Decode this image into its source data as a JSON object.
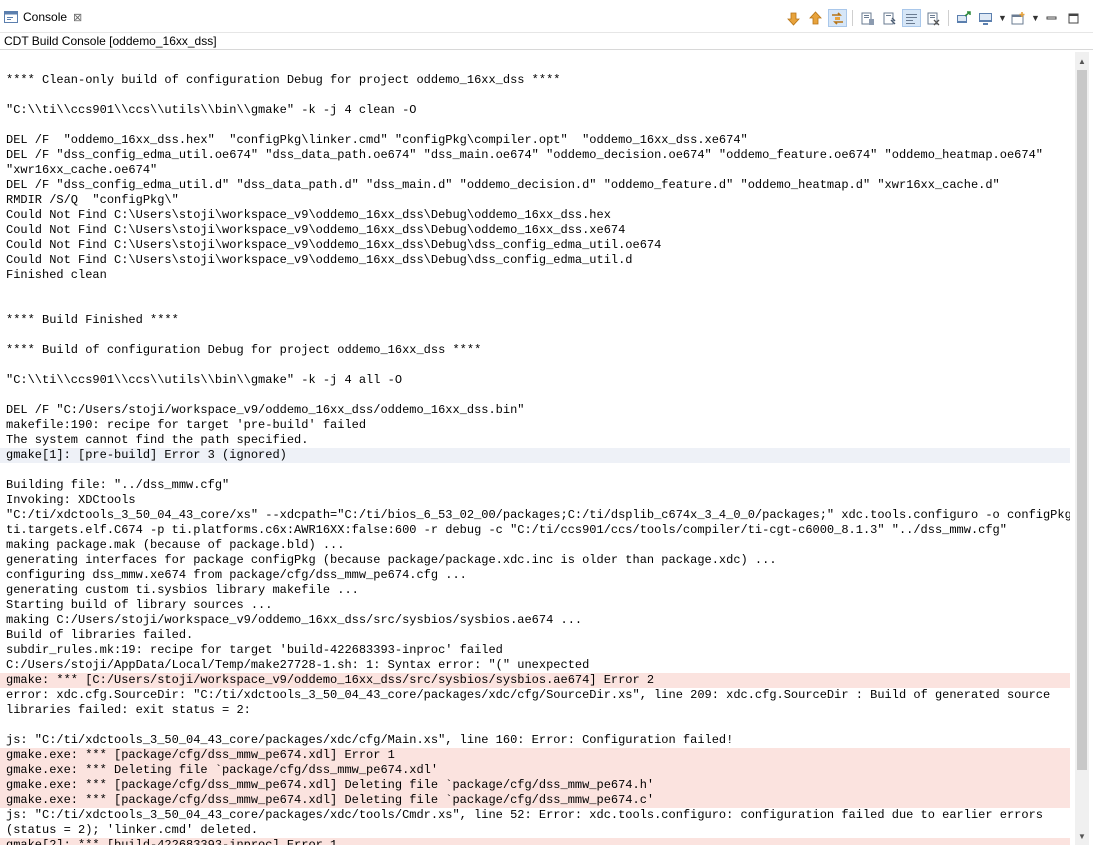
{
  "tab": {
    "title": "Console",
    "close": "⊠"
  },
  "subtitle": "CDT Build Console [oddemo_16xx_dss]",
  "colors": {
    "error_bg": "#fbe3df",
    "highlight_bg": "#eef1f7",
    "accent": "#e8a33c"
  },
  "console": {
    "lines": [
      {
        "text": "",
        "kind": "normal"
      },
      {
        "text": "**** Clean-only build of configuration Debug for project oddemo_16xx_dss ****",
        "kind": "normal"
      },
      {
        "text": "",
        "kind": "normal"
      },
      {
        "text": "\"C:\\\\ti\\\\ccs901\\\\ccs\\\\utils\\\\bin\\\\gmake\" -k -j 4 clean -O",
        "kind": "normal"
      },
      {
        "text": "",
        "kind": "normal"
      },
      {
        "text": "DEL /F  \"oddemo_16xx_dss.hex\"  \"configPkg\\linker.cmd\" \"configPkg\\compiler.opt\"  \"oddemo_16xx_dss.xe674\"",
        "kind": "normal"
      },
      {
        "text": "DEL /F \"dss_config_edma_util.oe674\" \"dss_data_path.oe674\" \"dss_main.oe674\" \"oddemo_decision.oe674\" \"oddemo_feature.oe674\" \"oddemo_heatmap.oe674\"",
        "kind": "normal"
      },
      {
        "text": "\"xwr16xx_cache.oe674\"",
        "kind": "normal"
      },
      {
        "text": "DEL /F \"dss_config_edma_util.d\" \"dss_data_path.d\" \"dss_main.d\" \"oddemo_decision.d\" \"oddemo_feature.d\" \"oddemo_heatmap.d\" \"xwr16xx_cache.d\"",
        "kind": "normal"
      },
      {
        "text": "RMDIR /S/Q  \"configPkg\\\"",
        "kind": "normal"
      },
      {
        "text": "Could Not Find C:\\Users\\stoji\\workspace_v9\\oddemo_16xx_dss\\Debug\\oddemo_16xx_dss.hex",
        "kind": "normal"
      },
      {
        "text": "Could Not Find C:\\Users\\stoji\\workspace_v9\\oddemo_16xx_dss\\Debug\\oddemo_16xx_dss.xe674",
        "kind": "normal"
      },
      {
        "text": "Could Not Find C:\\Users\\stoji\\workspace_v9\\oddemo_16xx_dss\\Debug\\dss_config_edma_util.oe674",
        "kind": "normal"
      },
      {
        "text": "Could Not Find C:\\Users\\stoji\\workspace_v9\\oddemo_16xx_dss\\Debug\\dss_config_edma_util.d",
        "kind": "normal"
      },
      {
        "text": "Finished clean",
        "kind": "normal"
      },
      {
        "text": "",
        "kind": "normal"
      },
      {
        "text": "",
        "kind": "normal"
      },
      {
        "text": "**** Build Finished ****",
        "kind": "normal"
      },
      {
        "text": "",
        "kind": "normal"
      },
      {
        "text": "**** Build of configuration Debug for project oddemo_16xx_dss ****",
        "kind": "normal"
      },
      {
        "text": "",
        "kind": "normal"
      },
      {
        "text": "\"C:\\\\ti\\\\ccs901\\\\ccs\\\\utils\\\\bin\\\\gmake\" -k -j 4 all -O",
        "kind": "normal"
      },
      {
        "text": "",
        "kind": "normal"
      },
      {
        "text": "DEL /F \"C:/Users/stoji/workspace_v9/oddemo_16xx_dss/oddemo_16xx_dss.bin\"",
        "kind": "normal"
      },
      {
        "text": "makefile:190: recipe for target 'pre-build' failed",
        "kind": "normal"
      },
      {
        "text": "The system cannot find the path specified.",
        "kind": "normal"
      },
      {
        "text": "gmake[1]: [pre-build] Error 3 (ignored)",
        "kind": "hl"
      },
      {
        "text": "",
        "kind": "normal"
      },
      {
        "text": "Building file: \"../dss_mmw.cfg\"",
        "kind": "normal"
      },
      {
        "text": "Invoking: XDCtools",
        "kind": "normal"
      },
      {
        "text": "\"C:/ti/xdctools_3_50_04_43_core/xs\" --xdcpath=\"C:/ti/bios_6_53_02_00/packages;C:/ti/dsplib_c674x_3_4_0_0/packages;\" xdc.tools.configuro -o configPkg -t",
        "kind": "normal"
      },
      {
        "text": "ti.targets.elf.C674 -p ti.platforms.c6x:AWR16XX:false:600 -r debug -c \"C:/ti/ccs901/ccs/tools/compiler/ti-cgt-c6000_8.1.3\" \"../dss_mmw.cfg\"",
        "kind": "normal"
      },
      {
        "text": "making package.mak (because of package.bld) ...",
        "kind": "normal"
      },
      {
        "text": "generating interfaces for package configPkg (because package/package.xdc.inc is older than package.xdc) ...",
        "kind": "normal"
      },
      {
        "text": "configuring dss_mmw.xe674 from package/cfg/dss_mmw_pe674.cfg ...",
        "kind": "normal"
      },
      {
        "text": "generating custom ti.sysbios library makefile ...",
        "kind": "normal"
      },
      {
        "text": "Starting build of library sources ...",
        "kind": "normal"
      },
      {
        "text": "making C:/Users/stoji/workspace_v9/oddemo_16xx_dss/src/sysbios/sysbios.ae674 ...",
        "kind": "normal"
      },
      {
        "text": "Build of libraries failed.",
        "kind": "normal"
      },
      {
        "text": "subdir_rules.mk:19: recipe for target 'build-422683393-inproc' failed",
        "kind": "normal"
      },
      {
        "text": "C:/Users/stoji/AppData/Local/Temp/make27728-1.sh: 1: Syntax error: \"(\" unexpected",
        "kind": "normal"
      },
      {
        "text": "gmake: *** [C:/Users/stoji/workspace_v9/oddemo_16xx_dss/src/sysbios/sysbios.ae674] Error 2",
        "kind": "err"
      },
      {
        "text": "error: xdc.cfg.SourceDir: \"C:/ti/xdctools_3_50_04_43_core/packages/xdc/cfg/SourceDir.xs\", line 209: xdc.cfg.SourceDir : Build of generated source",
        "kind": "normal"
      },
      {
        "text": "libraries failed: exit status = 2:",
        "kind": "normal"
      },
      {
        "text": "",
        "kind": "normal"
      },
      {
        "text": "js: \"C:/ti/xdctools_3_50_04_43_core/packages/xdc/cfg/Main.xs\", line 160: Error: Configuration failed!",
        "kind": "normal"
      },
      {
        "text": "gmake.exe: *** [package/cfg/dss_mmw_pe674.xdl] Error 1",
        "kind": "err"
      },
      {
        "text": "gmake.exe: *** Deleting file `package/cfg/dss_mmw_pe674.xdl'",
        "kind": "err"
      },
      {
        "text": "gmake.exe: *** [package/cfg/dss_mmw_pe674.xdl] Deleting file `package/cfg/dss_mmw_pe674.h'",
        "kind": "err"
      },
      {
        "text": "gmake.exe: *** [package/cfg/dss_mmw_pe674.xdl] Deleting file `package/cfg/dss_mmw_pe674.c'",
        "kind": "err"
      },
      {
        "text": "js: \"C:/ti/xdctools_3_50_04_43_core/packages/xdc/tools/Cmdr.xs\", line 52: Error: xdc.tools.configuro: configuration failed due to earlier errors",
        "kind": "normal"
      },
      {
        "text": "(status = 2); 'linker.cmd' deleted.",
        "kind": "normal"
      },
      {
        "text": "gmake[2]: *** [build-422683393-inproc] Error 1",
        "kind": "err"
      }
    ]
  },
  "toolbar": {
    "icons": [
      {
        "name": "next-error-icon",
        "active": false
      },
      {
        "name": "previous-error-icon",
        "active": false
      },
      {
        "name": "link-with-editor-icon",
        "active": true
      },
      {
        "sep": true
      },
      {
        "name": "scroll-lock-icon",
        "active": false
      },
      {
        "name": "pin-console-icon",
        "active": false
      },
      {
        "name": "word-wrap-icon",
        "active": true
      },
      {
        "name": "clear-console-icon",
        "active": false
      },
      {
        "sep": true
      },
      {
        "name": "open-console-icon",
        "active": false
      },
      {
        "name": "display-console-icon",
        "active": false,
        "caret": true
      },
      {
        "name": "new-console-icon",
        "active": false,
        "caret": true
      }
    ]
  }
}
